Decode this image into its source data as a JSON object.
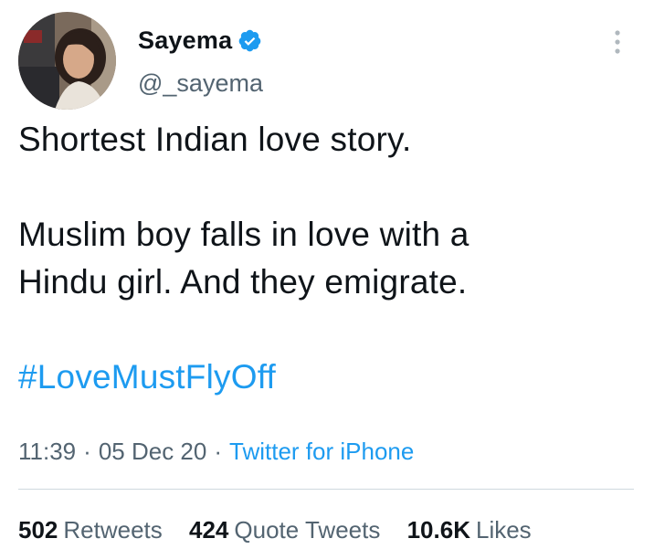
{
  "author": {
    "display_name": "Sayema",
    "handle": "@_sayema",
    "verified_icon": "verified-badge-icon",
    "avatar_icon": "profile-photo"
  },
  "tweet": {
    "lines_para1": [
      "Shortest Indian love story."
    ],
    "lines_para2": [
      "Muslim boy falls in love with a",
      "Hindu girl. And they emigrate."
    ],
    "hashtag": "#LoveMustFlyOff"
  },
  "meta": {
    "time": "11:39",
    "date": "05 Dec 20",
    "source": "Twitter for iPhone",
    "separator": "·"
  },
  "stats": [
    {
      "value": "502",
      "label": "Retweets"
    },
    {
      "value": "424",
      "label": "Quote Tweets"
    },
    {
      "value": "10.6K",
      "label": "Likes"
    }
  ],
  "colors": {
    "accent": "#1d9bf0",
    "text": "#0f1419",
    "secondary": "#536471",
    "divider": "#cfd9de"
  },
  "more_icon": "more-vertical-icon"
}
